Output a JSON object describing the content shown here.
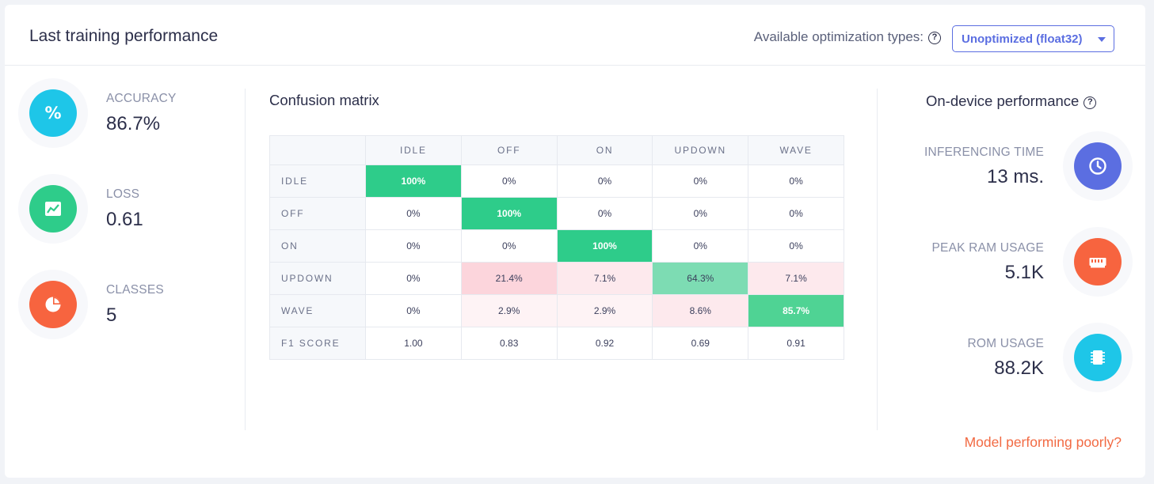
{
  "header": {
    "title": "Last training performance",
    "optimization_label": "Available optimization types:",
    "optimization_selected": "Unoptimized (float32)"
  },
  "metrics": [
    {
      "label": "ACCURACY",
      "value": "86.7%",
      "icon": "percent-icon",
      "color": "#1ec6e8"
    },
    {
      "label": "LOSS",
      "value": "0.61",
      "icon": "line-chart-icon",
      "color": "#2ecc8a"
    },
    {
      "label": "CLASSES",
      "value": "5",
      "icon": "pie-chart-icon",
      "color": "#f7643f"
    }
  ],
  "confusion_matrix": {
    "title": "Confusion matrix",
    "columns": [
      "IDLE",
      "OFF",
      "ON",
      "UPDOWN",
      "WAVE"
    ],
    "rows": [
      {
        "label": "IDLE",
        "cells": [
          "100%",
          "0%",
          "0%",
          "0%",
          "0%"
        ]
      },
      {
        "label": "OFF",
        "cells": [
          "0%",
          "100%",
          "0%",
          "0%",
          "0%"
        ]
      },
      {
        "label": "ON",
        "cells": [
          "0%",
          "0%",
          "100%",
          "0%",
          "0%"
        ]
      },
      {
        "label": "UPDOWN",
        "cells": [
          "0%",
          "21.4%",
          "7.1%",
          "64.3%",
          "7.1%"
        ]
      },
      {
        "label": "WAVE",
        "cells": [
          "0%",
          "2.9%",
          "2.9%",
          "8.6%",
          "85.7%"
        ]
      }
    ],
    "f1": {
      "label": "F1 SCORE",
      "cells": [
        "1.00",
        "0.83",
        "0.92",
        "0.69",
        "0.91"
      ]
    },
    "colors": {
      "correct_strong": "#2ecc8a",
      "correct_medium": "#7ddcb3",
      "correct_high": "#4fd394",
      "error_strong": "#fcd5dc",
      "error_light": "#fde9ed",
      "error_faint": "#fef3f5"
    }
  },
  "on_device": {
    "title": "On-device performance",
    "items": [
      {
        "label": "INFERENCING TIME",
        "value": "13 ms.",
        "icon": "clock-icon",
        "color": "#5b6ee1"
      },
      {
        "label": "PEAK RAM USAGE",
        "value": "5.1K",
        "icon": "ram-icon",
        "color": "#f7643f"
      },
      {
        "label": "ROM USAGE",
        "value": "88.2K",
        "icon": "chip-icon",
        "color": "#1ec6e8"
      }
    ]
  },
  "footer_link": "Model performing poorly?"
}
